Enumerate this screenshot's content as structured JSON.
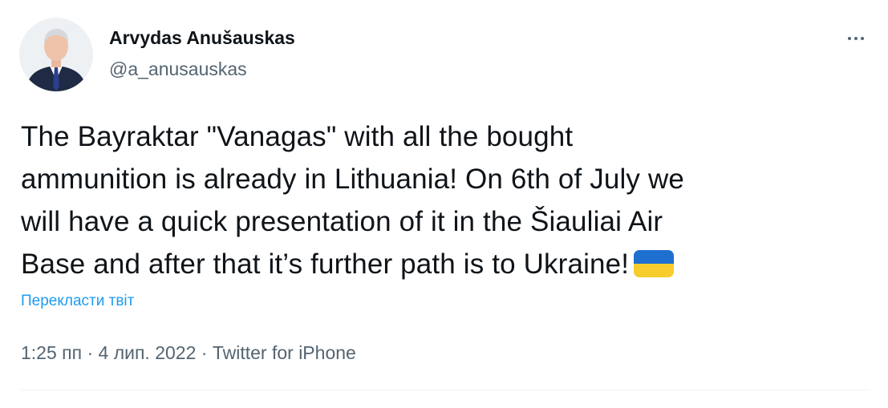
{
  "author": {
    "display_name": "Arvydas Anušauskas",
    "handle": "@a_anusauskas"
  },
  "tweet": {
    "line1": "The Bayraktar \"Vanagas\" with all the bought",
    "line2": "ammunition is already in Lithuania! On 6th of July we",
    "line3": "will have a quick presentation of it in the Šiauliai Air",
    "line4": "Base and after that it’s further path is to Ukraine!",
    "flag_icon": "ukraine-flag-icon"
  },
  "translate_label": "Перекласти твіт",
  "meta": {
    "time": "1:25 пп",
    "separator": "·",
    "date": "4 лип. 2022",
    "source": "Twitter for iPhone"
  },
  "colors": {
    "text": "#0f1419",
    "secondary": "#536471",
    "link": "#1d9bf0",
    "flag_blue": "#1f6fd1",
    "flag_yellow": "#f7cd2d"
  },
  "icons": {
    "more": "more-dots-icon"
  }
}
